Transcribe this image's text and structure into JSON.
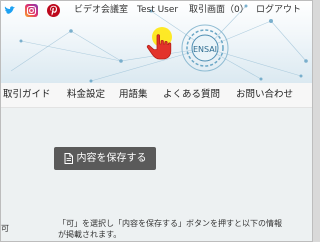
{
  "header": {
    "social": [
      {
        "icon": "twitter-icon",
        "color": "#1da1f2"
      },
      {
        "icon": "instagram-icon",
        "color": "#e1306c"
      },
      {
        "icon": "pinterest-icon",
        "color": "#bd081c"
      }
    ],
    "top_links": [
      "ビデオ会議室",
      "Test User",
      "取引画面（0）",
      "ログアウト"
    ],
    "hub_label": "ENSAI"
  },
  "menu": {
    "items": [
      "取引ガイド",
      "料金設定",
      "用語集",
      "よくある質問",
      "お問い合わせ"
    ]
  },
  "main": {
    "save_button_label": "内容を保存する",
    "note_line1": "「可」を選択し「内容を保存する」ボタンを押すと以下の情報",
    "note_line2": "が掲載されます。",
    "left_fragment": "可"
  }
}
